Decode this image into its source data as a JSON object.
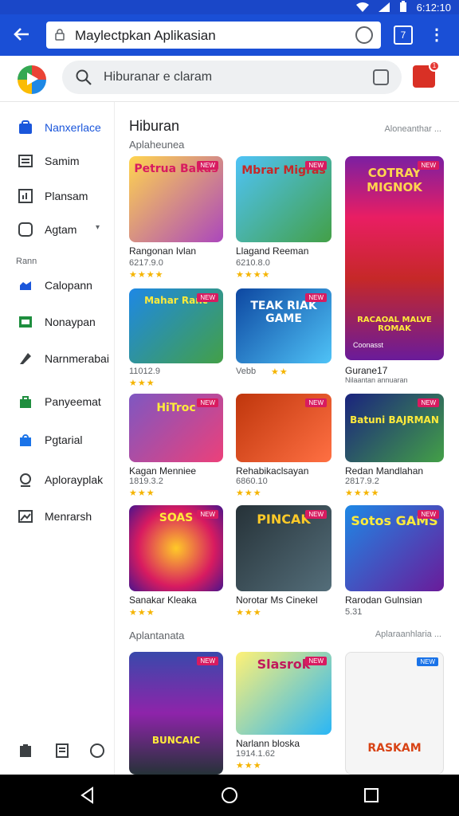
{
  "status": {
    "time": "6:12:10"
  },
  "browser": {
    "url": "Maylectpkan Aplikasian",
    "tabs": "7"
  },
  "header": {
    "search_placeholder": "Hiburanar e claram"
  },
  "sidebar": {
    "items": [
      {
        "label": "Nanxerlace",
        "icon": "store-icon",
        "active": true
      },
      {
        "label": "Samim",
        "icon": "list-icon"
      },
      {
        "label": "Plansam",
        "icon": "chart-icon"
      },
      {
        "label": "Agtam",
        "icon": "tablet-icon"
      },
      {
        "label": "Calopann",
        "icon": "cloud-upload-icon"
      },
      {
        "label": "Nonaypan",
        "icon": "message-icon"
      },
      {
        "label": "Narnmerabai",
        "icon": "tag-icon"
      },
      {
        "label": "Panyeemat",
        "icon": "shop-icon"
      },
      {
        "label": "Pgtarial",
        "icon": "bag-icon"
      },
      {
        "label": "Aplorayplak",
        "icon": "search-user-icon"
      },
      {
        "label": "Menrarsh",
        "icon": "image-icon"
      }
    ],
    "section_label": "Rann"
  },
  "main": {
    "title": "Hiburan",
    "subtitle": "Aplaheunea",
    "more": "Aloneanthar ...",
    "section2_title": "Aplantanata",
    "section2_more": "Aplaraanhlaria ...",
    "cards": [
      {
        "name": "Rangonan Ivlan",
        "meta": "6217.9.0",
        "stars": "★★★★",
        "art": "Petrua Bakus",
        "tag": "NEW"
      },
      {
        "name": "Llagand Reeman",
        "meta": "6210.8.0",
        "stars": "★★★★",
        "art": "Mbrar Migras",
        "tag": "NEW"
      },
      {
        "name": "Gurane17",
        "meta": "Nilaantan annuaran",
        "stars": "",
        "art": "COTRAY MIGNOK",
        "tag": "NEW"
      },
      {
        "name": "",
        "meta": "11012.9",
        "stars": "★★★",
        "art": "Mahar Ranc",
        "tag": "NEW"
      },
      {
        "name": "",
        "meta": "Vebb",
        "stars": "★★",
        "art": "TEAK RIAK GAME",
        "tag": "NEW"
      },
      {
        "name": "Kagan Menniee",
        "meta": "1819.3.2",
        "stars": "★★★",
        "art": "HiTroc",
        "tag": "NEW"
      },
      {
        "name": "Rehabikaclsayan",
        "meta": "6860.10",
        "stars": "★★★",
        "art": "",
        "tag": "NEW"
      },
      {
        "name": "Redan Mandlahan",
        "meta": "2817.9.2",
        "stars": "★★★★",
        "art": "Batuni BAJRMAN",
        "tag": "NEW"
      },
      {
        "name": "Sanakar Kleaka",
        "meta": "",
        "stars": "★★★",
        "art": "SOAS",
        "tag": "NEW"
      },
      {
        "name": "Norotar Ms Cinekel",
        "meta": "",
        "stars": "★★★",
        "art": "PINCAK",
        "tag": "NEW"
      },
      {
        "name": "Rarodan Gulnsian",
        "meta": "5.31",
        "stars": "",
        "art": "Sotos GAMS",
        "tag": "NEW"
      },
      {
        "name": "",
        "meta": "",
        "stars": "",
        "art": "BUNCAIC",
        "tag": "NEW"
      },
      {
        "name": "Narlann bloska",
        "meta": "1914.1.62",
        "stars": "★★★",
        "art": "Slasrok",
        "tag": "NEW"
      },
      {
        "name": "",
        "meta": "",
        "stars": "",
        "art": "RASKAM",
        "tag": "NEW"
      }
    ],
    "big_card_caption": "RACAOAL MALVE ROMAK",
    "big_card_sub": "Coonasst"
  },
  "colors": {
    "accent": "#1a4fd6",
    "star": "#f5b400",
    "tag": "#d81b60"
  }
}
